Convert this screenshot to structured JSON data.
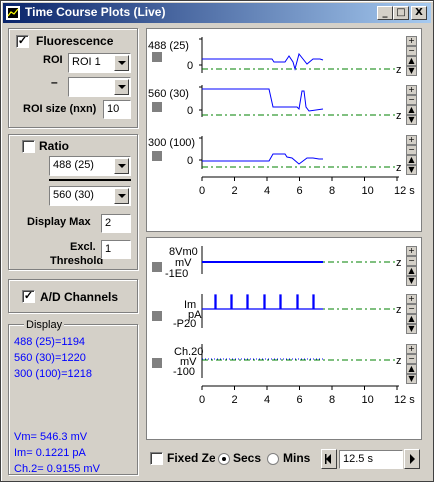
{
  "window": {
    "title": "Time Course Plots (Live)",
    "minimize": "_",
    "maximize": "□",
    "close": "X"
  },
  "fluorescence": {
    "checked": "✓",
    "label": "Fluorescence",
    "roi_label": "ROI",
    "roi_value": "ROI 1",
    "minus_label": "–",
    "second_value": "",
    "roi_size_label": "ROI size (nxn)",
    "roi_size_value": "10"
  },
  "ratio": {
    "checked": "",
    "label": "Ratio",
    "numerator": "488 (25)",
    "denominator": "560 (30)",
    "display_max_label": "Display Max",
    "display_max_value": "2",
    "excl_label_1": "Excl.",
    "excl_label_2": "Threshold",
    "excl_value": "1"
  },
  "ad": {
    "checked": "✓",
    "label": "A/D Channels"
  },
  "display": {
    "label": "Display",
    "fluor_readouts": [
      "488 (25)=1194",
      "560 (30)=1220",
      "300 (100)=1218"
    ],
    "ad_readouts": [
      "Vm=  546.3 mV",
      "Im= 0.1221 pA",
      "Ch.2= 0.9155 mV"
    ]
  },
  "top_plot": {
    "traces": [
      {
        "label": "488 (25)",
        "ytop": "",
        "ybottom": "0",
        "zero": "z"
      },
      {
        "label": "560 (30)",
        "ytop": "",
        "ybottom": "0",
        "zero": "z"
      },
      {
        "label": "300 (100)",
        "ytop": "",
        "ybottom": "0",
        "zero": "z"
      }
    ],
    "x_ticks": [
      "0",
      "2",
      "4",
      "6",
      "8",
      "10",
      "12 s"
    ]
  },
  "bottom_plot": {
    "traces": [
      {
        "label1": "8Vm0",
        "label2": "mV",
        "label3": "-1E0"
      },
      {
        "label1": "Im",
        "label2": "pA",
        "label3": "-P20"
      },
      {
        "label1": "Ch.20",
        "label2": "mV",
        "label3": "-100"
      }
    ],
    "zero": "z",
    "x_ticks": [
      "0",
      "2",
      "4",
      "6",
      "8",
      "10",
      "12 s"
    ]
  },
  "bottom_bar": {
    "fixed_zero_label": "Fixed Zero",
    "secs_label": "Secs",
    "mins_label": "Mins",
    "time_value": "12.5 s"
  },
  "colors": {
    "trace": "#0000ff",
    "zero_line": "#008000",
    "titlebar": "#0a246a"
  }
}
